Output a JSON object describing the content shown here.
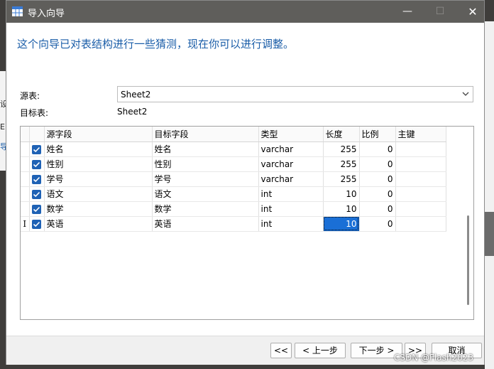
{
  "window": {
    "title": "导入向导",
    "minimize_glyph": "—",
    "maximize_glyph": "☐",
    "close_glyph": "✕"
  },
  "heading": "这个向导已对表结构进行一些猜测，现在你可以进行调整。",
  "source": {
    "label": "源表:",
    "value": "Sheet2"
  },
  "target": {
    "label": "目标表:",
    "value": "Sheet2"
  },
  "table": {
    "columns": [
      "源字段",
      "目标字段",
      "类型",
      "长度",
      "比例",
      "主键"
    ],
    "rows": [
      {
        "checked": true,
        "source": "姓名",
        "target": "姓名",
        "type": "varchar",
        "length": "255",
        "scale": "0",
        "key": ""
      },
      {
        "checked": true,
        "source": "性别",
        "target": "性别",
        "type": "varchar",
        "length": "255",
        "scale": "0",
        "key": ""
      },
      {
        "checked": true,
        "source": "学号",
        "target": "学号",
        "type": "varchar",
        "length": "255",
        "scale": "0",
        "key": ""
      },
      {
        "checked": true,
        "source": "语文",
        "target": "语文",
        "type": "int",
        "length": "10",
        "scale": "0",
        "key": ""
      },
      {
        "checked": true,
        "source": "数学",
        "target": "数学",
        "type": "int",
        "length": "10",
        "scale": "0",
        "key": ""
      },
      {
        "checked": true,
        "source": "英语",
        "target": "英语",
        "type": "int",
        "length": "10",
        "scale": "0",
        "key": ""
      }
    ],
    "row_indicator": "I"
  },
  "buttons": {
    "first": "<<",
    "prev": "< 上一步",
    "next": "下一步 >",
    "last": ">>",
    "cancel": "取消"
  },
  "watermark": "CSDN @Flash2023",
  "colors": {
    "accent": "#1a5da8",
    "checkbox": "#1f62b5",
    "selection": "#1a6fd6",
    "titlebar": "#5f5e5b"
  },
  "background": {
    "left_glyphs": [
      "设",
      "E",
      "导"
    ]
  }
}
